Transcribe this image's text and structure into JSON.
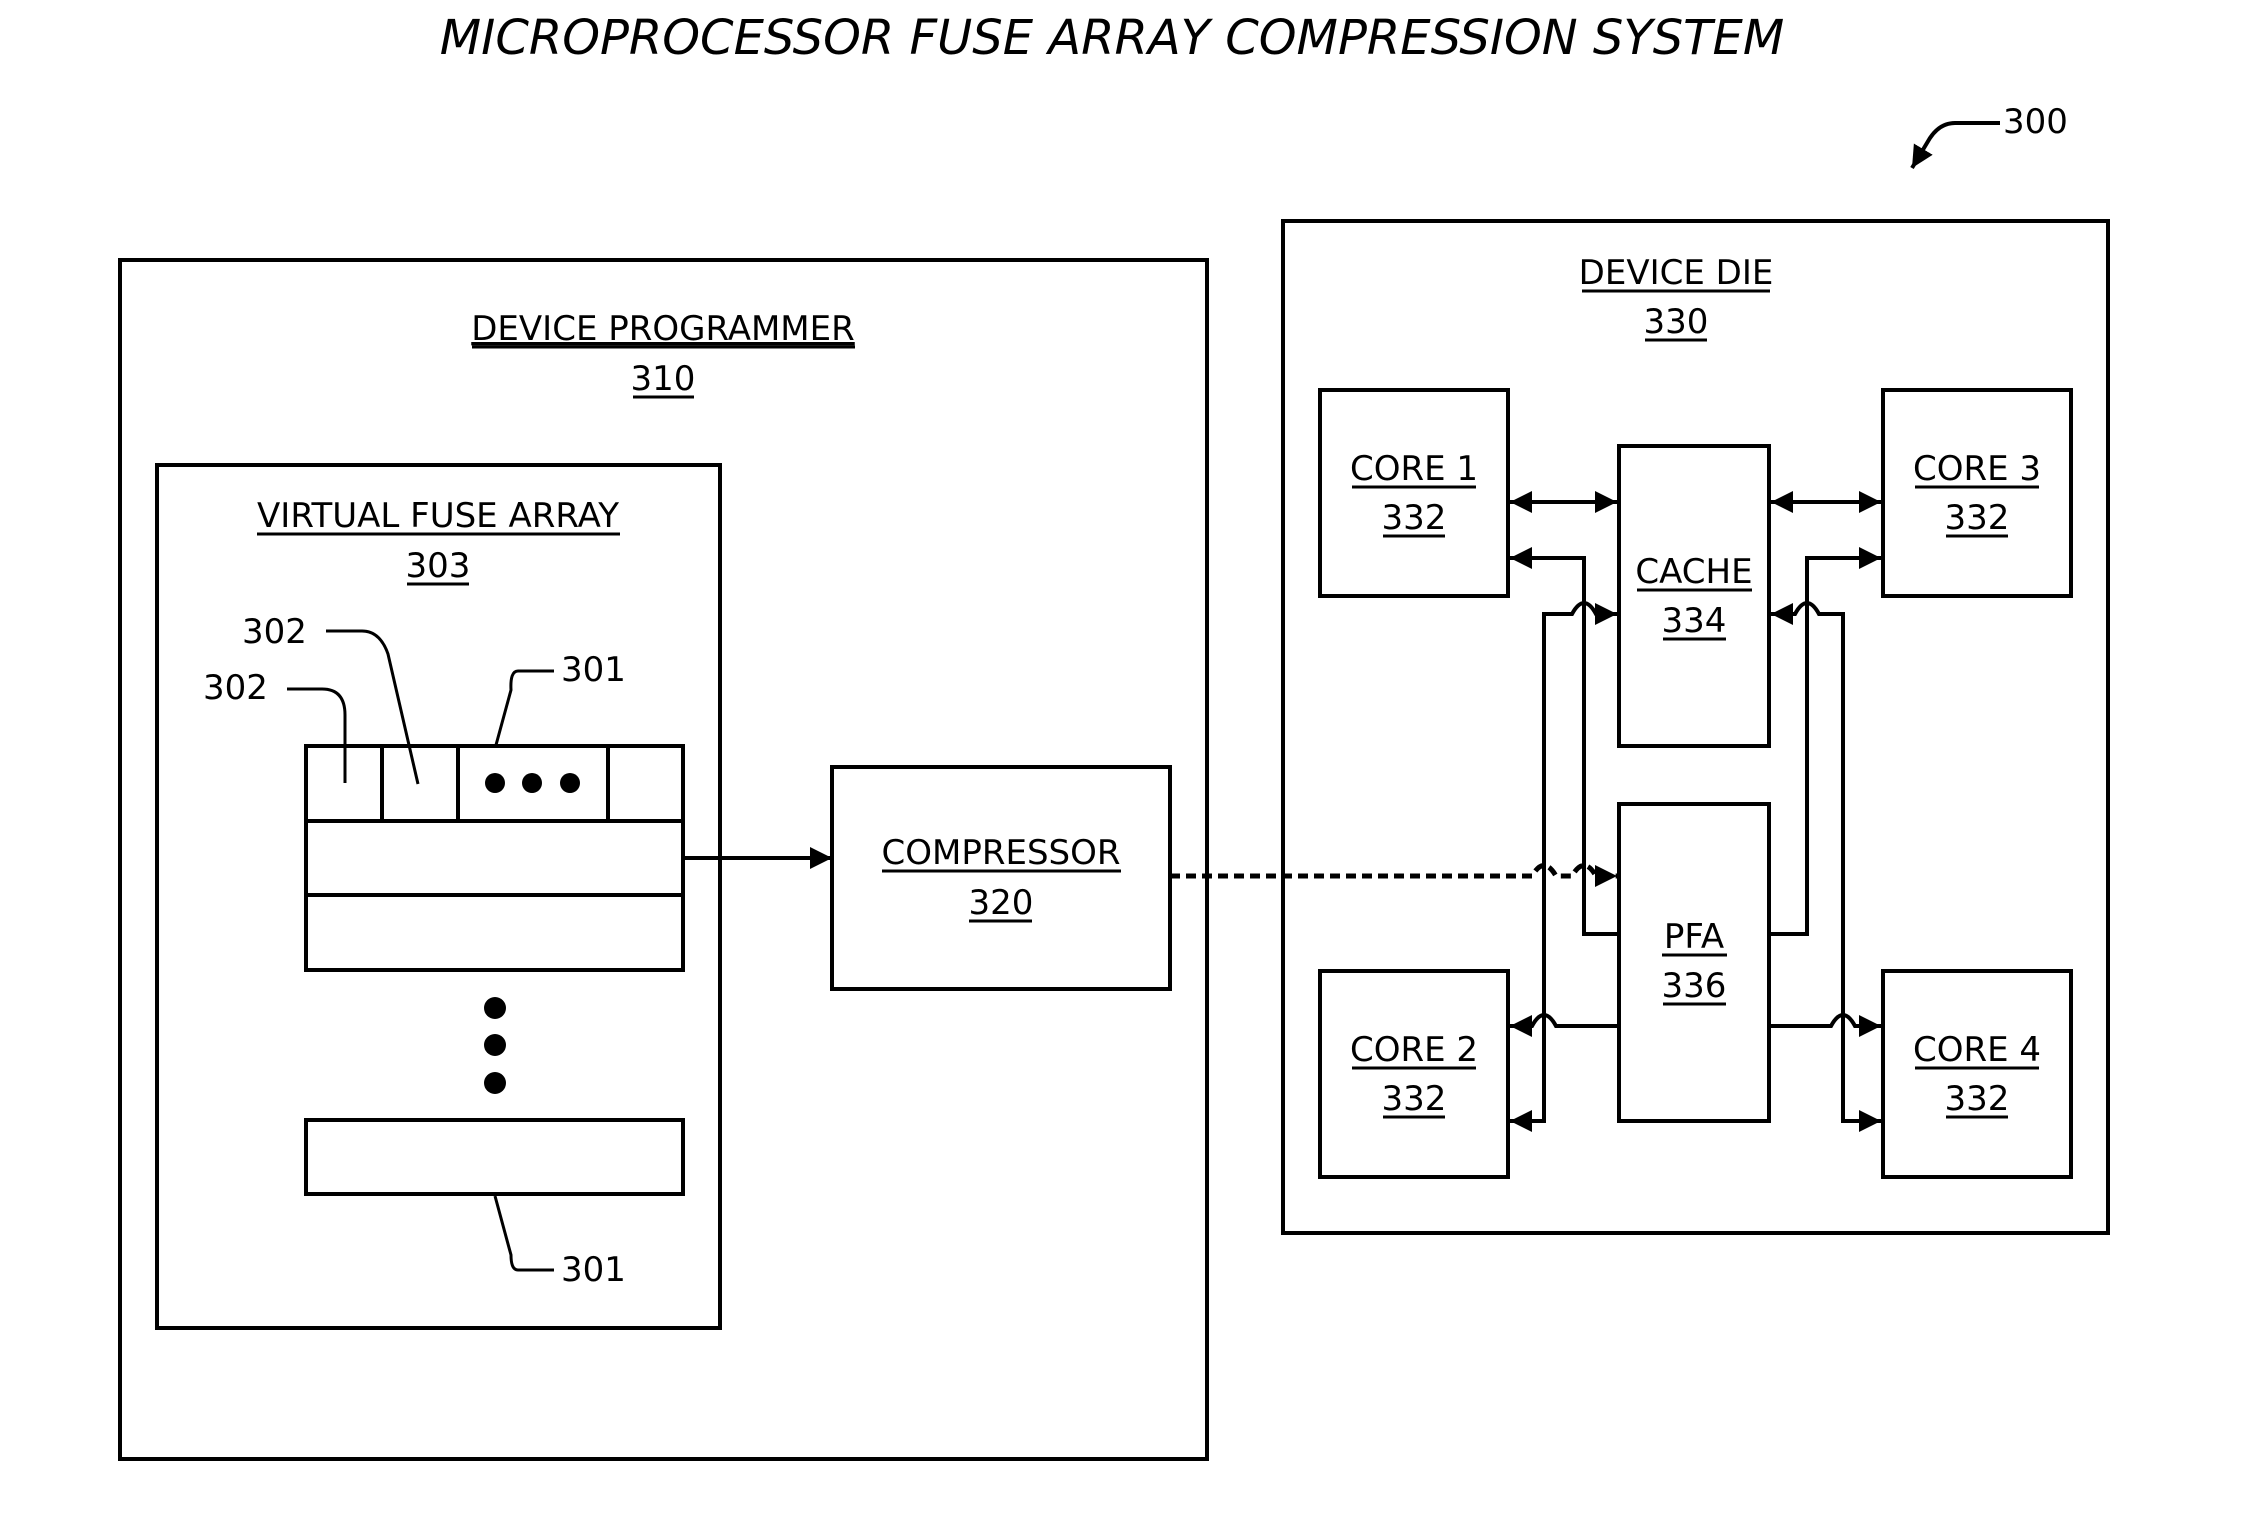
{
  "title": "MICROPROCESSOR FUSE ARRAY COMPRESSION SYSTEM",
  "figure_ref": "300",
  "device_programmer": {
    "name": "DEVICE PROGRAMMER",
    "ref": "310"
  },
  "virtual_fuse_array": {
    "name": "VIRTUAL FUSE ARRAY",
    "ref": "303",
    "callouts": {
      "fuse_a": "302",
      "fuse_b": "302",
      "row_top": "301",
      "row_bottom": "301"
    }
  },
  "compressor": {
    "name": "COMPRESSOR",
    "ref": "320"
  },
  "device_die": {
    "name": "DEVICE DIE",
    "ref": "330",
    "cores": [
      {
        "name": "CORE 1",
        "ref": "332"
      },
      {
        "name": "CORE 2",
        "ref": "332"
      },
      {
        "name": "CORE 3",
        "ref": "332"
      },
      {
        "name": "CORE 4",
        "ref": "332"
      }
    ],
    "cache": {
      "name": "CACHE",
      "ref": "334"
    },
    "pfa": {
      "name": "PFA",
      "ref": "336"
    }
  },
  "colors": {
    "line": "#000000",
    "background": "#ffffff"
  }
}
